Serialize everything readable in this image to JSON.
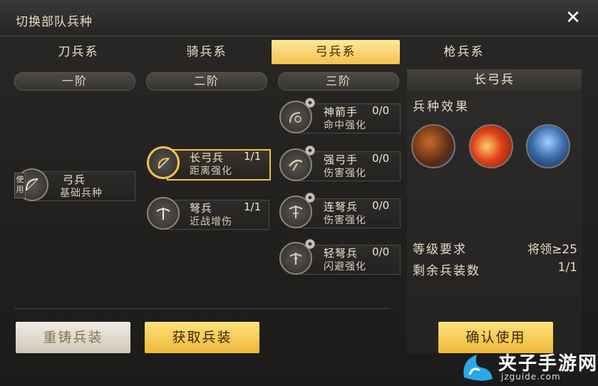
{
  "window": {
    "title": "切换部队兵种",
    "close_label": "✕"
  },
  "tabs": [
    {
      "label": "刀兵系",
      "active": false
    },
    {
      "label": "骑兵系",
      "active": false
    },
    {
      "label": "弓兵系",
      "active": true
    },
    {
      "label": "枪兵系",
      "active": false
    }
  ],
  "tiers": [
    "一阶",
    "二阶",
    "三阶"
  ],
  "tier1": {
    "name": "弓兵",
    "desc": "基础兵种",
    "used_tag": "使用"
  },
  "tier2": [
    {
      "name": "长弓兵",
      "count": "1/1",
      "desc": "距离强化",
      "selected": true
    },
    {
      "name": "弩兵",
      "count": "1/1",
      "desc": "近战增伤",
      "selected": false
    }
  ],
  "tier3": [
    {
      "name": "神箭手",
      "count": "0/0",
      "desc": "命中强化"
    },
    {
      "name": "强弓手",
      "count": "0/0",
      "desc": "伤害强化"
    },
    {
      "name": "连弩兵",
      "count": "0/0",
      "desc": "伤害强化"
    },
    {
      "name": "轻弩兵",
      "count": "0/0",
      "desc": "闪避强化"
    }
  ],
  "panel": {
    "title": "长弓兵",
    "effects_label": "兵种效果",
    "skills": [
      "archer-portrait",
      "fire-slash",
      "armored-warrior"
    ],
    "level_req_label": "等级要求",
    "level_req_value": "将领≥25",
    "remaining_label": "剩余兵装数",
    "remaining_value": "1/1"
  },
  "buttons": {
    "reforge": "重铸兵装",
    "obtain": "获取兵装",
    "confirm": "确认使用"
  },
  "watermark": {
    "text": "夹子手游网",
    "url_text": "jzguide.com"
  },
  "colors": {
    "accent_gold": "#f1c14c",
    "panel_bg": "#2d2b29"
  }
}
